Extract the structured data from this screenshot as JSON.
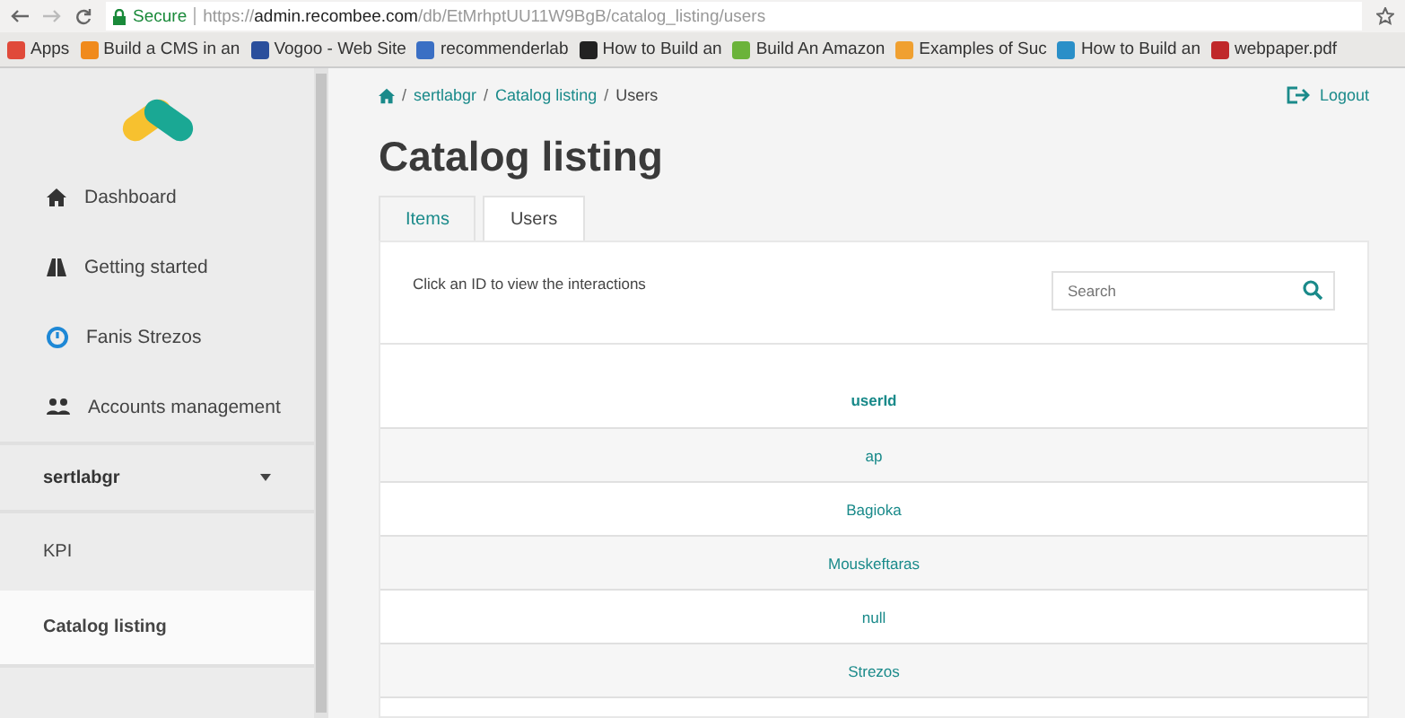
{
  "browser": {
    "secure_label": "Secure",
    "url_scheme": "https://",
    "url_host": "admin.recombee.com",
    "url_path": "/db/EtMrhptUU11W9BgB/catalog_listing/users",
    "bookmarks": [
      {
        "label": "Apps",
        "color": "#e04a3a"
      },
      {
        "label": "Build a CMS in an",
        "color": "#f08a1c"
      },
      {
        "label": "Vogoo - Web Site",
        "color": "#2b4f9c"
      },
      {
        "label": "recommenderlab",
        "color": "#3a6fc4"
      },
      {
        "label": "How to Build an",
        "color": "#222222"
      },
      {
        "label": "Build An Amazon",
        "color": "#6bb33a"
      },
      {
        "label": "Examples of Suc",
        "color": "#f0a030"
      },
      {
        "label": "How to Build an",
        "color": "#2a8fc8"
      },
      {
        "label": "webpaper.pdf",
        "color": "#c0282a"
      }
    ]
  },
  "sidebar": {
    "items": [
      {
        "label": "Dashboard",
        "selected": false
      },
      {
        "label": "Getting started",
        "selected": false
      },
      {
        "label": "Fanis Strezos",
        "selected": false
      },
      {
        "label": "Accounts management",
        "selected": false
      }
    ],
    "database": {
      "label": "sertlabgr",
      "expanded": true
    },
    "db_items": [
      {
        "label": "KPI",
        "selected": false
      },
      {
        "label": "Catalog listing",
        "selected": true
      }
    ]
  },
  "breadcrumb": [
    "sertlabgr",
    "Catalog listing",
    "Users"
  ],
  "breadcrumb_separator": "/",
  "logout": "Logout",
  "title": "Catalog listing",
  "tabs": [
    {
      "label": "Items",
      "selected": false
    },
    {
      "label": "Users",
      "selected": true
    }
  ],
  "hint": "Click an ID to view the interactions",
  "search": {
    "placeholder": "Search"
  },
  "table": {
    "column": "userId",
    "rows": [
      "ap",
      "Bagioka",
      "Mouskeftaras",
      "null",
      "Strezos"
    ]
  }
}
